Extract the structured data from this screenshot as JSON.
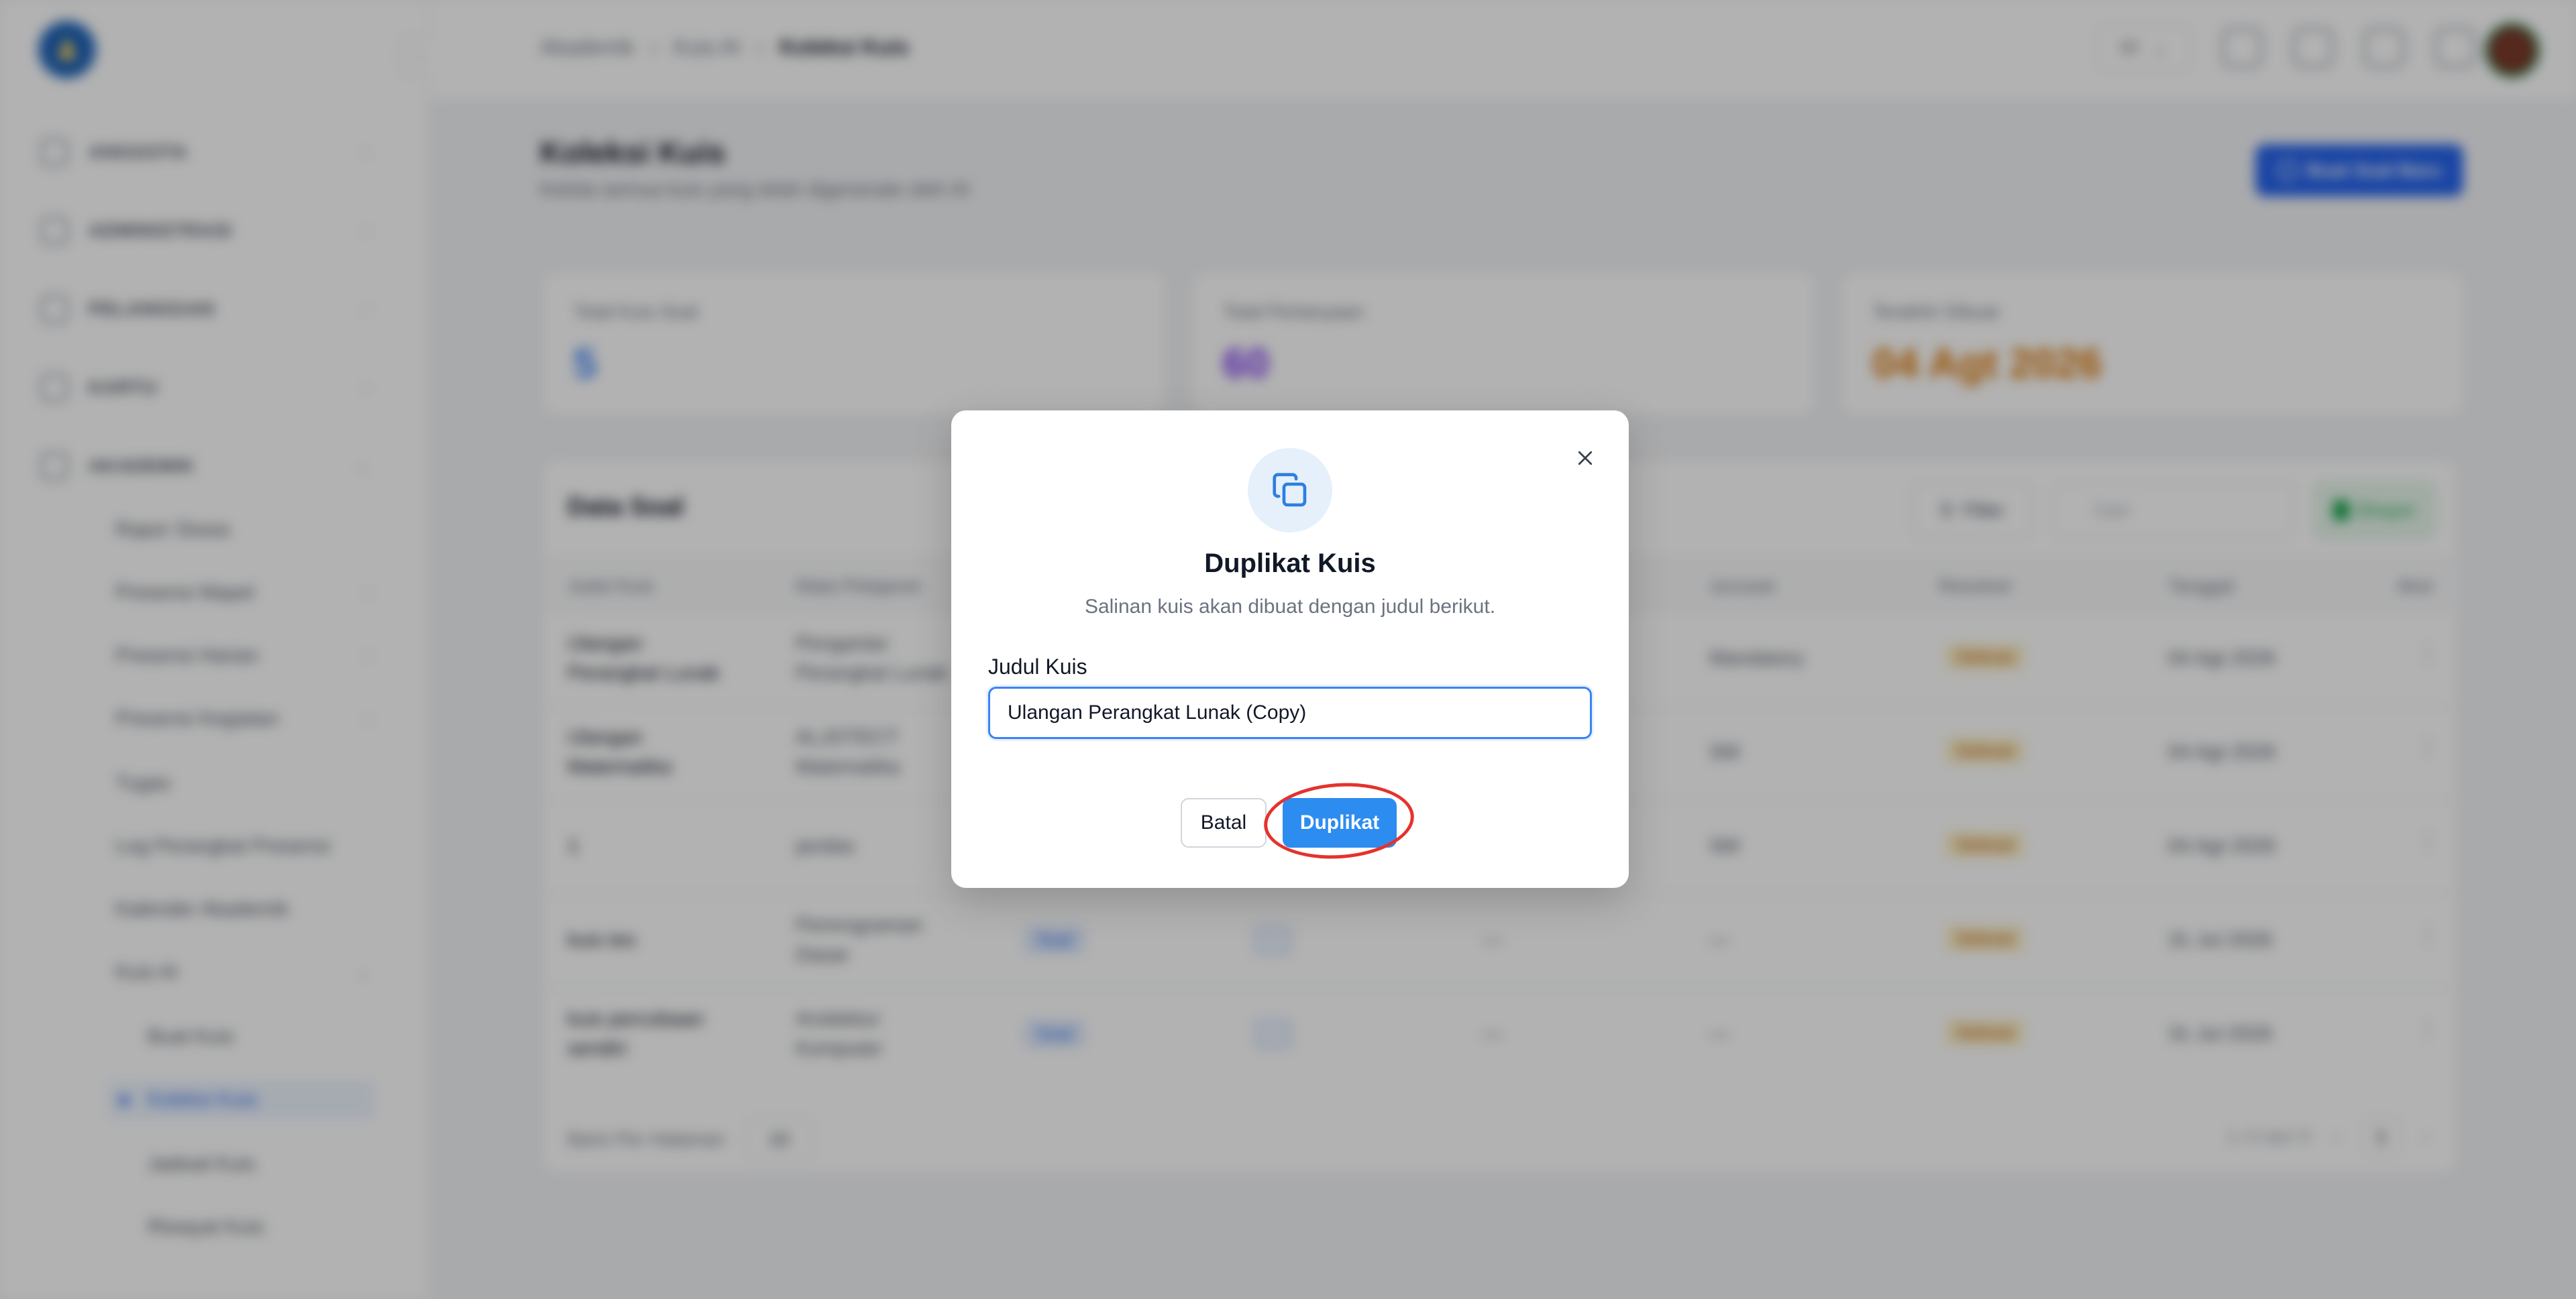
{
  "sidebar": {
    "collapse_icon": "chevron-left-icon",
    "groups": [
      {
        "label": "ANGGOTA",
        "icon": "users-icon"
      },
      {
        "label": "ADMINISTRASI",
        "icon": "clipboard-icon"
      },
      {
        "label": "PELANGGAN",
        "icon": "store-icon"
      },
      {
        "label": "KARTU",
        "icon": "card-icon"
      },
      {
        "label": "AKADEMIK",
        "icon": "book-icon"
      }
    ],
    "academic_items": [
      {
        "label": "Rapor Siswa"
      },
      {
        "label": "Presensi Mapel"
      },
      {
        "label": "Presensi Harian"
      },
      {
        "label": "Presensi Kegiatan"
      },
      {
        "label": "Tugas"
      },
      {
        "label": "Log Perangkat Presensi"
      },
      {
        "label": "Kalender Akademik"
      },
      {
        "label": "Kuis AI"
      }
    ],
    "quiz_items": [
      {
        "label": "Buat Kuis"
      },
      {
        "label": "Koleksi Kuis"
      },
      {
        "label": "Jadwal Kuis"
      },
      {
        "label": "Riwayat Kuis"
      }
    ]
  },
  "topbar": {
    "breadcrumb": [
      "Akademik",
      "Kuis AI",
      "Koleksi Kuis"
    ],
    "lang_label": "ID"
  },
  "page": {
    "title": "Koleksi Kuis",
    "subtitle": "Kelola semua kuis yang telah digenerate oleh AI",
    "create_label": "Buat Soal Baru"
  },
  "stats": [
    {
      "label": "Total Kuis Soal",
      "value": "5",
      "color": "#3b82f6"
    },
    {
      "label": "Total Pertanyaan",
      "value": "60",
      "color": "#7c3aed"
    },
    {
      "label": "Terakhir Dibuat",
      "value": "04 Agt 2026",
      "color": "#d97706"
    }
  ],
  "table": {
    "title": "Data Soal",
    "filter_label": "Filter",
    "search_placeholder": "Cari",
    "export_label": "Ekspor",
    "headers": [
      "Judul Kuis",
      "Mata Pelajaran",
      "Jurusan",
      "Resolver",
      "Tanggal",
      "Akst"
    ],
    "rows": [
      {
        "title": "Ulangan\nPerangkat Lunak",
        "subject": "Pengantar\nPerangkat Lunak",
        "jurusan": "Mandatory",
        "status": "Selesai",
        "date": "04 Agt 2026"
      },
      {
        "title": "Ulangan\nMatematika",
        "subject": "ALJOTECT\nMatematika",
        "jurusan": "SM",
        "status": "Selesai",
        "date": "04 Agt 2026"
      },
      {
        "title": "1",
        "subject": "jandas",
        "jurusan": "SM",
        "status": "Selesai",
        "date": "04 Agt 2026"
      },
      {
        "title": "kuis tes",
        "subject": "Pemrograman\nDasar",
        "tag": "Soal",
        "dash1": "—",
        "dash2": "—",
        "status": "Selesai",
        "date": "31 Jul 2026"
      },
      {
        "title": "kuis percobaan\nsendiri",
        "subject": "Arsitektur\nKomputer",
        "tag": "Soal",
        "dash1": "—",
        "dash2": "—",
        "status": "Selesai",
        "date": "31 Jul 2026"
      }
    ],
    "footer": {
      "per_page_label": "Baris Per Halaman",
      "per_page_value": "10",
      "range": "1–5 dari 5",
      "current_page": "1"
    }
  },
  "modal": {
    "icon": "copy-icon",
    "close_icon": "close-icon",
    "title": "Duplikat Kuis",
    "description": "Salinan kuis akan dibuat dengan judul berikut.",
    "field_label": "Judul Kuis",
    "field_value": "Ulangan Perangkat Lunak (Copy)",
    "cancel_label": "Batal",
    "confirm_label": "Duplikat",
    "accent_color": "#2d8cf0",
    "highlight_color": "#e5322d"
  }
}
